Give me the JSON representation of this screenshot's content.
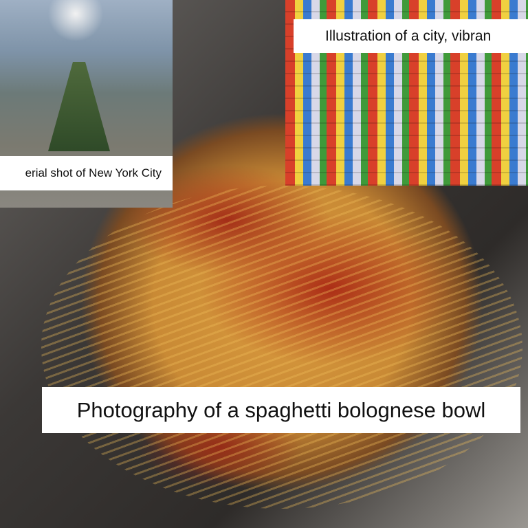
{
  "captions": {
    "nyc": "erial shot of New York City",
    "city": "Illustration of a city, vibran",
    "spaghetti": "Photography of a spaghetti bolognese bowl"
  }
}
